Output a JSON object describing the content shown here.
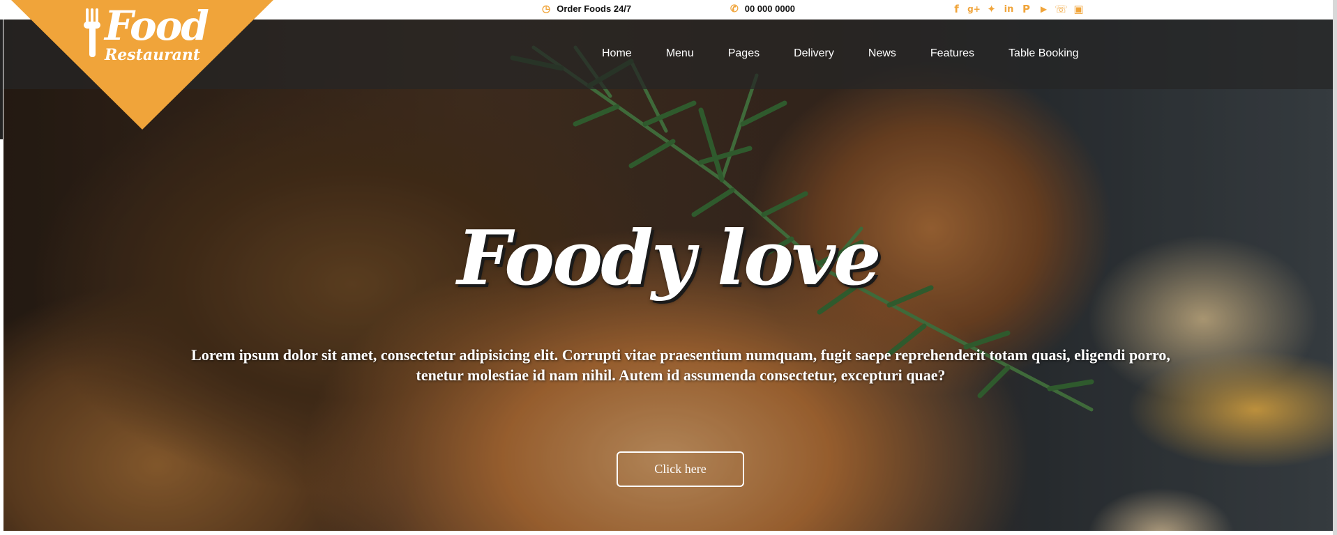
{
  "topbar": {
    "orders": {
      "icon": "clock-icon",
      "label": "Order Foods 24/7"
    },
    "phone": {
      "icon": "phone-icon",
      "label": "00 000 0000"
    },
    "social": [
      {
        "name": "facebook-icon",
        "glyph": "f"
      },
      {
        "name": "google-plus-icon",
        "glyph": "g+"
      },
      {
        "name": "twitter-icon",
        "glyph": "t"
      },
      {
        "name": "linkedin-icon",
        "glyph": "in"
      },
      {
        "name": "pinterest-icon",
        "glyph": "p"
      },
      {
        "name": "youtube-icon",
        "glyph": "yt"
      },
      {
        "name": "whatsapp-icon",
        "glyph": "w"
      },
      {
        "name": "instagram-icon",
        "glyph": "ig"
      }
    ]
  },
  "logo": {
    "line1": "Food",
    "line2": "Restaurant",
    "icon": "fork-icon",
    "color": "#f0a43a"
  },
  "nav": {
    "items": [
      {
        "label": "Home"
      },
      {
        "label": "Menu"
      },
      {
        "label": "Pages"
      },
      {
        "label": "Delivery"
      },
      {
        "label": "News"
      },
      {
        "label": "Features"
      },
      {
        "label": "Table Booking"
      }
    ]
  },
  "hero": {
    "headline": "Foody love",
    "description": "Lorem ipsum dolor sit amet, consectetur adipisicing elit. Corrupti vitae praesentium numquam, fugit saepe reprehenderit totam quasi, eligendi porro, tenetur molestiae id nam nihil. Autem id assumenda consectetur, excepturi quae?",
    "cta_label": "Click here"
  },
  "colors": {
    "accent": "#f0a43a",
    "navbar": "#262626",
    "text": "#ffffff"
  }
}
